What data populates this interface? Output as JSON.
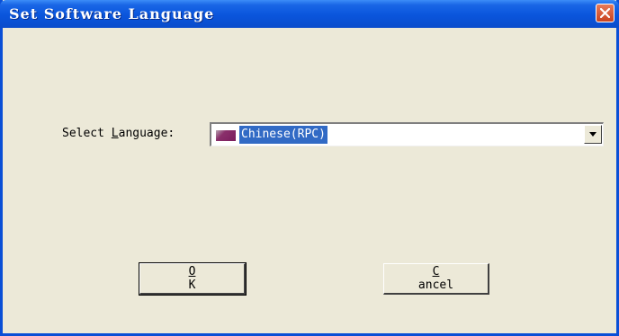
{
  "window": {
    "title": "Set Software Language"
  },
  "form": {
    "label_prefix": "Select ",
    "label_mnemonic": "L",
    "label_suffix": "anguage:",
    "selected_language": "Chinese(RPC)"
  },
  "buttons": {
    "ok_mnemonic": "O",
    "ok_rest": "K",
    "cancel_mnemonic": "C",
    "cancel_rest": "ancel"
  },
  "icons": {
    "close": "close-icon",
    "dropdown": "chevron-down-icon",
    "flag": "flag-icon"
  },
  "colors": {
    "titlebar": "#0A55DC",
    "window_bg": "#ECE9D8",
    "selection": "#316AC5",
    "close_button": "#D2532E"
  }
}
